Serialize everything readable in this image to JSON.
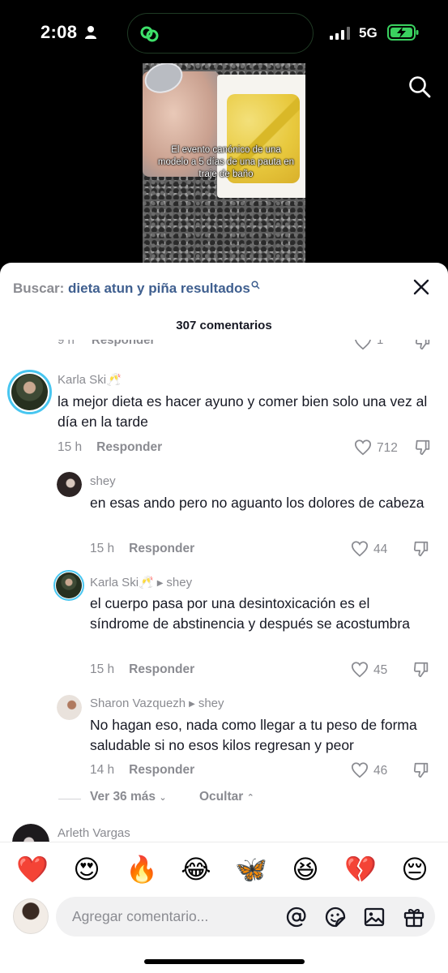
{
  "status_bar": {
    "time": "2:08",
    "network": "5G",
    "icons": [
      "person-icon",
      "island-app-icon",
      "signal-icon",
      "battery-charging-icon"
    ]
  },
  "video": {
    "caption": "El evento canónico de una modelo a 5 días de una pauta en traje de baño",
    "search_icon": "search-icon"
  },
  "sheet": {
    "search_prefix": "Buscar:",
    "search_query": "dieta atun y piña resultados",
    "comment_count": "307 comentarios",
    "cut_row": {
      "time": "9 h",
      "reply": "Responder",
      "likes": "1"
    },
    "comments": [
      {
        "author": "Karla Ski🥂",
        "text": "la mejor dieta es hacer ayuno y comer bien solo una vez al día en la tarde",
        "time": "15 h",
        "reply": "Responder",
        "likes": "712"
      },
      {
        "author": "shey",
        "text": "en esas ando pero no aguanto los dolores de cabeza",
        "time": "15 h",
        "reply": "Responder",
        "likes": "44"
      },
      {
        "author": "Karla Ski🥂",
        "reply_to": "shey",
        "text": "el cuerpo pasa por una desintoxicación es el síndrome de abstinencia y después se acostumbra",
        "time": "15 h",
        "reply": "Responder",
        "likes": "45"
      },
      {
        "author": "Sharon Vazquezh",
        "reply_to": "shey",
        "text": "No hagan eso, nada como llegar a tu peso de forma saludable si no esos kilos regresan y peor",
        "time": "14 h",
        "reply": "Responder",
        "likes": "46"
      }
    ],
    "view_more": "Ver 36 más",
    "hide": "Ocultar",
    "next_author": "Arleth Vargas",
    "emojis": [
      "❤️",
      "😍",
      "🔥",
      "😂",
      "🦋",
      "😆",
      "💔",
      "😔"
    ],
    "input_placeholder": "Agregar comentario...",
    "input_tools": [
      "at-mention-icon",
      "sticker-icon",
      "image-icon",
      "gift-icon"
    ]
  },
  "colors": {
    "accent_link": "#3f5f8f",
    "muted": "#8a8b91",
    "text": "#161823",
    "avatar_ring": "#48c6f0"
  }
}
